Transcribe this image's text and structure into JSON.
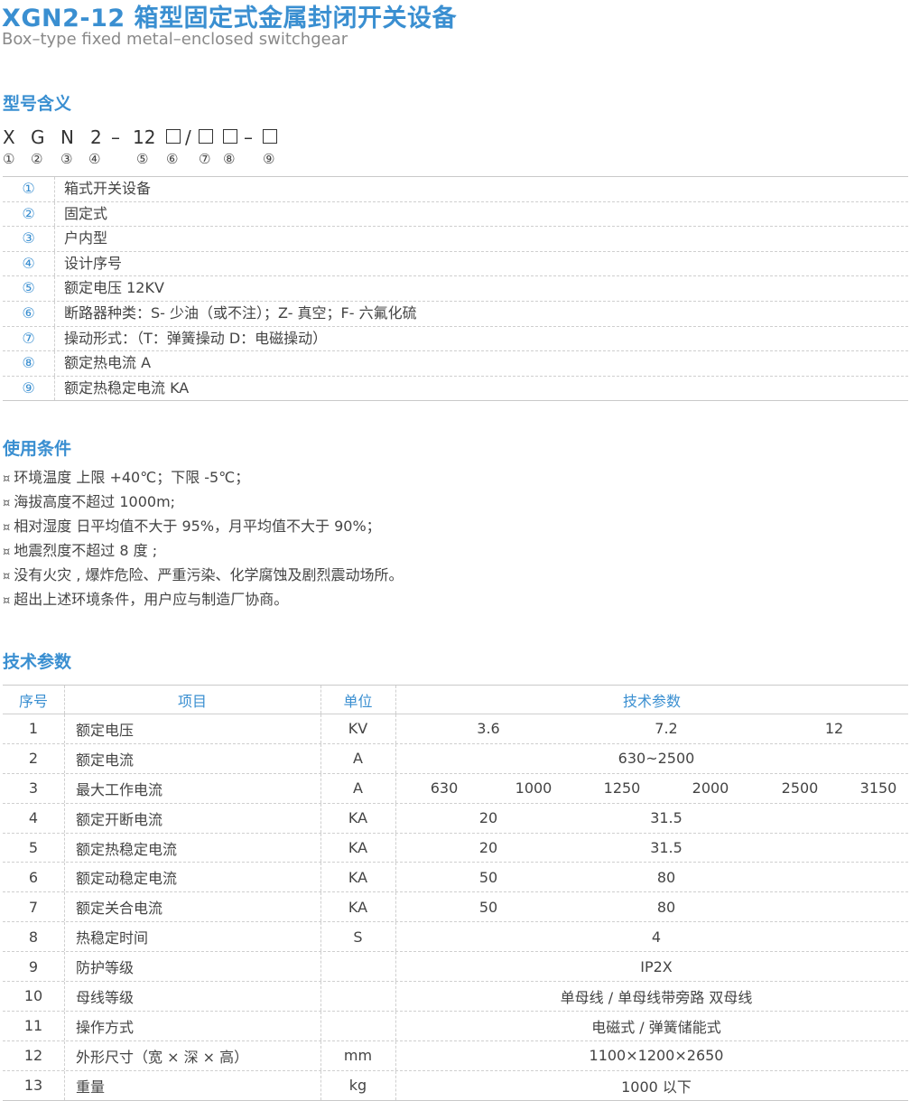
{
  "header": {
    "title": "XGN2-12 箱型固定式金属封闭开关设备",
    "subtitle": "Box–type fixed metal–enclosed switchgear"
  },
  "model_meaning": {
    "heading": "型号含义",
    "code_parts": [
      "X",
      "G",
      "N",
      "2",
      "–",
      "12",
      "/",
      "–"
    ],
    "numbers": [
      "①",
      "②",
      "③",
      "④",
      "⑤",
      "⑥",
      "⑦",
      "⑧",
      "⑨"
    ],
    "definitions": [
      {
        "num": "①",
        "text": "箱式开关设备"
      },
      {
        "num": "②",
        "text": "固定式"
      },
      {
        "num": "③",
        "text": "户内型"
      },
      {
        "num": "④",
        "text": "设计序号"
      },
      {
        "num": "⑤",
        "text": "额定电压 12KV"
      },
      {
        "num": "⑥",
        "text": "断路器种类：S- 少油（或不注）；Z- 真空；F- 六氟化硫"
      },
      {
        "num": "⑦",
        "text": "操动形式：（T：弹簧操动 D：电磁操动）"
      },
      {
        "num": "⑧",
        "text": "额定热电流 A"
      },
      {
        "num": "⑨",
        "text": "额定热稳定电流 KA"
      }
    ]
  },
  "conditions": {
    "heading": "使用条件",
    "bullet": "¤",
    "items": [
      "环境温度  上限 +40℃；下限 -5℃；",
      "海拔高度不超过 1000m;",
      "相对湿度  日平均值不大于 95%，月平均值不大于 90%；",
      "地震烈度不超过 8 度 ;",
      "没有火灾 , 爆炸危险、严重污染、化学腐蚀及剧烈震动场所。",
      "超出上述环境条件，用户应与制造厂协商。"
    ]
  },
  "params": {
    "heading": "技术参数",
    "columns": {
      "seq": "序号",
      "item": "项目",
      "unit": "单位",
      "values": "技术参数"
    },
    "rows": [
      {
        "seq": "1",
        "item": "额定电压",
        "unit": "KV",
        "values": [
          "3.6",
          "7.2",
          "12"
        ]
      },
      {
        "seq": "2",
        "item": "额定电流",
        "unit": "A",
        "values": [
          "630~2500"
        ]
      },
      {
        "seq": "3",
        "item": "最大工作电流",
        "unit": "A",
        "values": [
          "630",
          "1000",
          "1250",
          "2000",
          "2500",
          "3150"
        ]
      },
      {
        "seq": "4",
        "item": "额定开断电流",
        "unit": "KA",
        "values": [
          "20",
          "31.5"
        ]
      },
      {
        "seq": "5",
        "item": "额定热稳定电流",
        "unit": "KA",
        "values": [
          "20",
          "31.5"
        ]
      },
      {
        "seq": "6",
        "item": "额定动稳定电流",
        "unit": "KA",
        "values": [
          "50",
          "80"
        ]
      },
      {
        "seq": "7",
        "item": "额定关合电流",
        "unit": "KA",
        "values": [
          "50",
          "80"
        ]
      },
      {
        "seq": "8",
        "item": "热稳定时间",
        "unit": "S",
        "values": [
          "4"
        ]
      },
      {
        "seq": "9",
        "item": "防护等级",
        "unit": "",
        "values": [
          "IP2X"
        ]
      },
      {
        "seq": "10",
        "item": "母线等级",
        "unit": "",
        "values": [
          "单母线 / 单母线带旁路 双母线"
        ]
      },
      {
        "seq": "11",
        "item": "操作方式",
        "unit": "",
        "values": [
          "电磁式 / 弹簧储能式"
        ]
      },
      {
        "seq": "12",
        "item": "外形尺寸（宽 × 深 × 高）",
        "unit": "mm",
        "values": [
          "1100×1200×2650"
        ]
      },
      {
        "seq": "13",
        "item": "重量",
        "unit": "kg",
        "values": [
          "1000 以下"
        ]
      }
    ]
  }
}
